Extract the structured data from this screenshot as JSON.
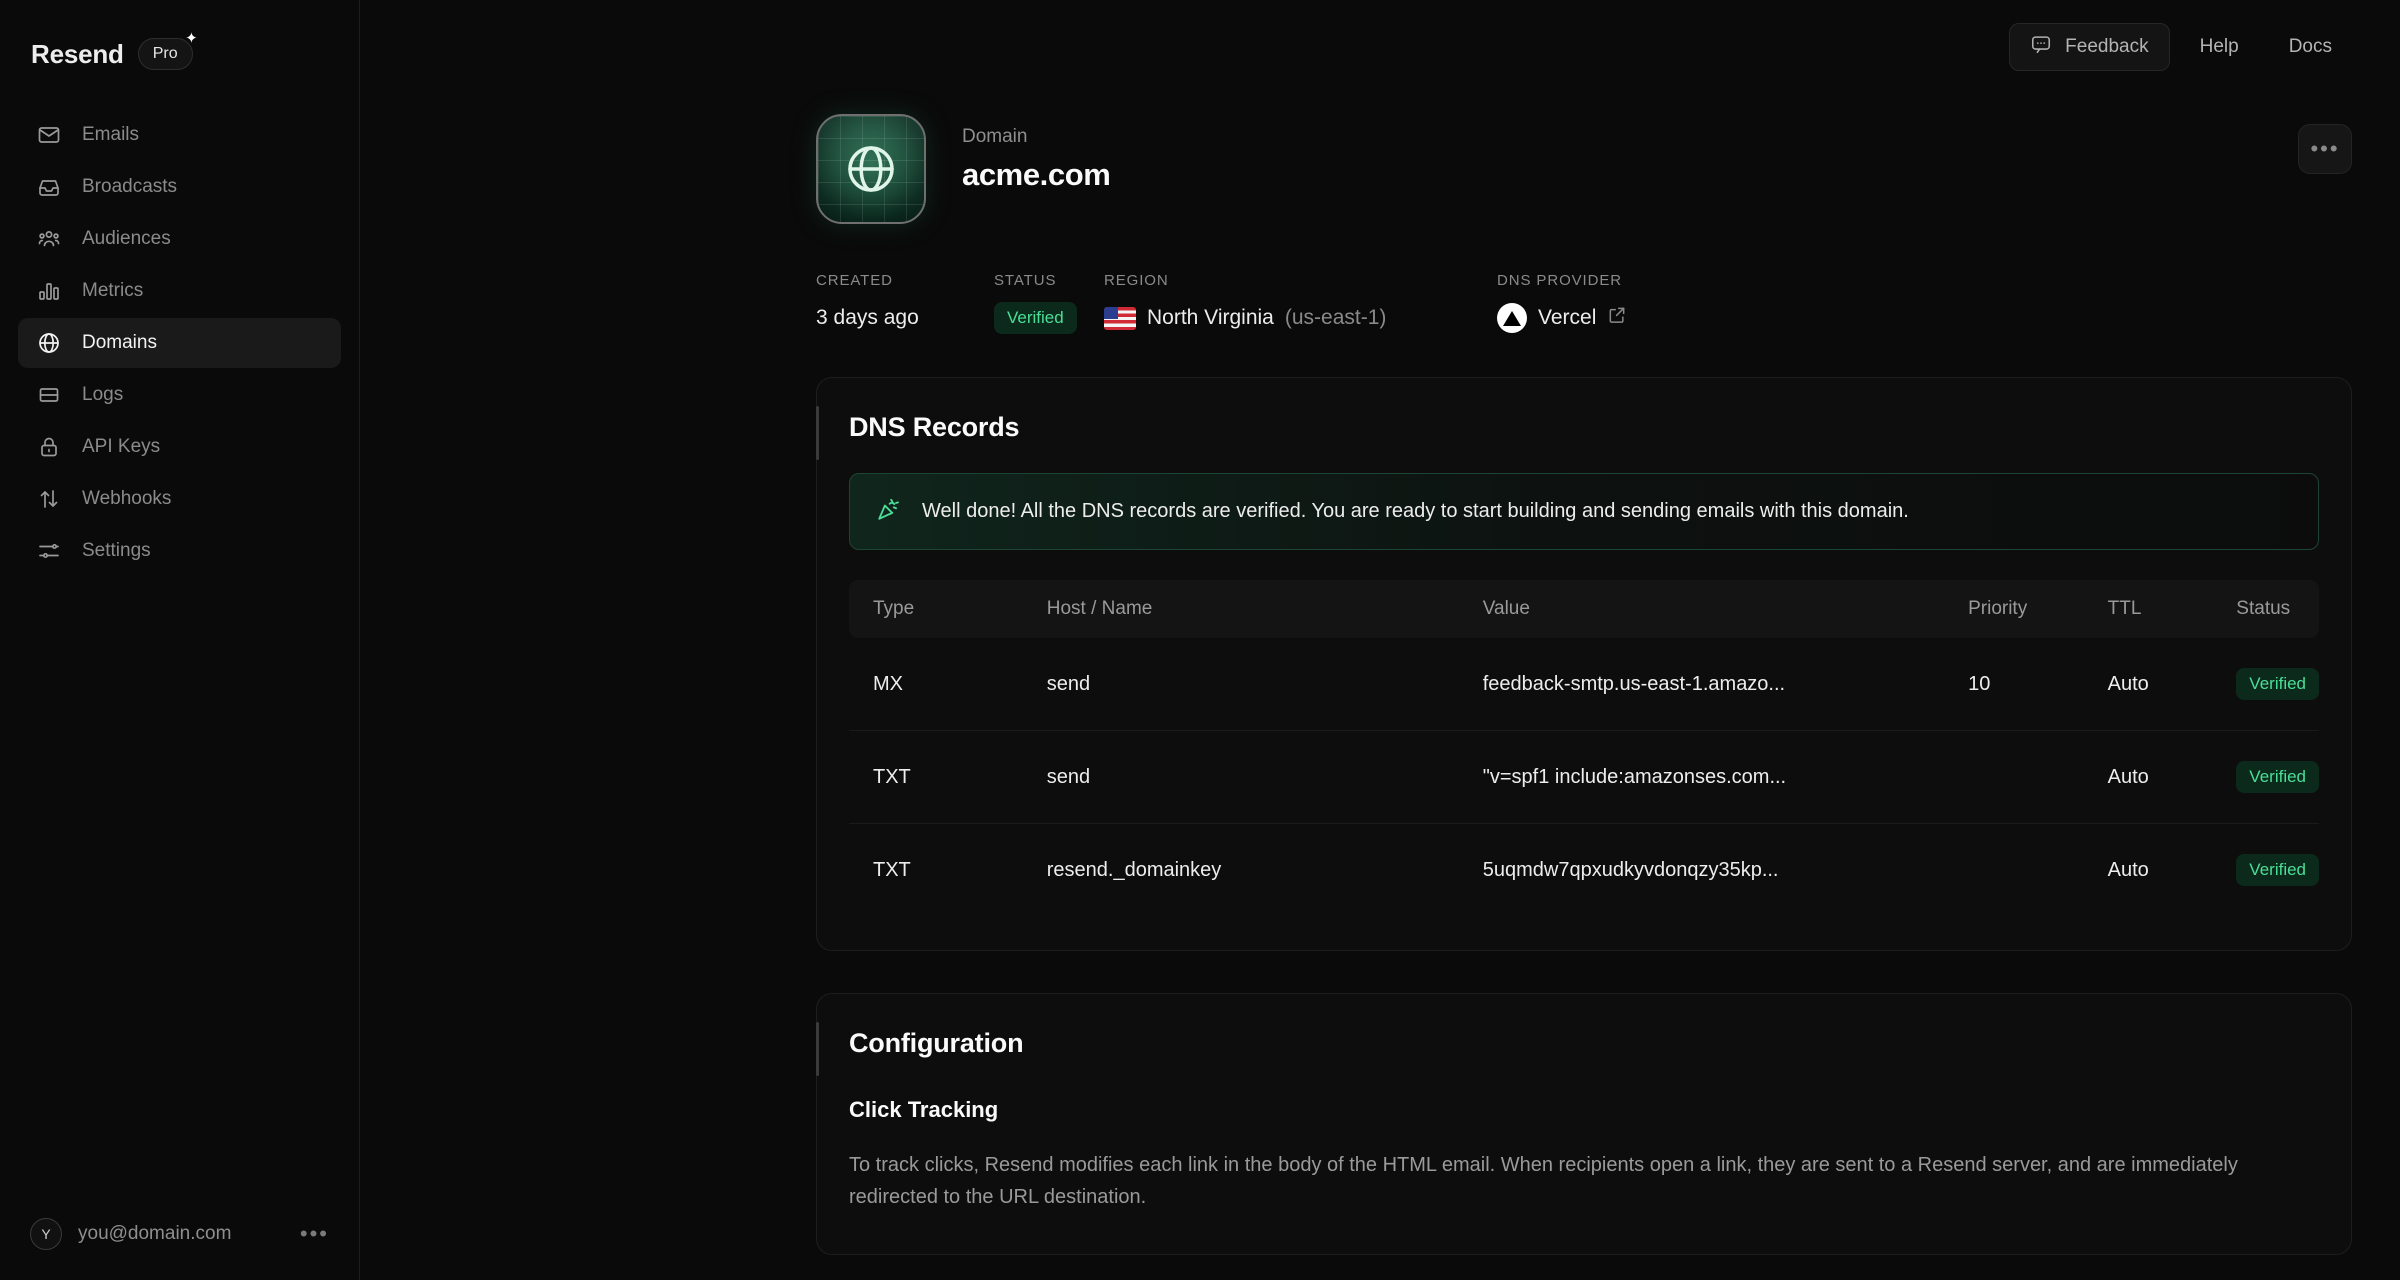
{
  "sidebar": {
    "brand": "Resend",
    "plan_badge": "Pro",
    "items": [
      {
        "label": "Emails",
        "icon": "envelope-icon",
        "active": false
      },
      {
        "label": "Broadcasts",
        "icon": "inbox-icon",
        "active": false
      },
      {
        "label": "Audiences",
        "icon": "people-icon",
        "active": false
      },
      {
        "label": "Metrics",
        "icon": "bar-chart-icon",
        "active": false
      },
      {
        "label": "Domains",
        "icon": "globe-icon",
        "active": true
      },
      {
        "label": "Logs",
        "icon": "list-icon",
        "active": false
      },
      {
        "label": "API Keys",
        "icon": "lock-icon",
        "active": false
      },
      {
        "label": "Webhooks",
        "icon": "arrows-updown-icon",
        "active": false
      },
      {
        "label": "Settings",
        "icon": "sliders-icon",
        "active": false
      }
    ],
    "user": {
      "avatar_initial": "Y",
      "email": "you@domain.com",
      "menu_dots": "•••"
    }
  },
  "topbar": {
    "feedback_label": "Feedback",
    "help_label": "Help",
    "docs_label": "Docs"
  },
  "domain_header": {
    "label": "Domain",
    "name": "acme.com",
    "more_dots": "•••"
  },
  "meta": {
    "created_key": "CREATED",
    "created_value": "3 days ago",
    "status_key": "STATUS",
    "status_value": "Verified",
    "region_key": "REGION",
    "region_value": "North Virginia",
    "region_code": "(us-east-1)",
    "dns_provider_key": "DNS PROVIDER",
    "dns_provider_value": "Vercel"
  },
  "dns_card": {
    "title": "DNS Records",
    "banner": "Well done! All the DNS records are verified. You are ready to start building and sending emails with this domain.",
    "columns": [
      "Type",
      "Host / Name",
      "Value",
      "Priority",
      "TTL",
      "Status"
    ],
    "rows": [
      {
        "type": "MX",
        "host": "send",
        "value": "feedback-smtp.us-east-1.amazo...",
        "priority": "10",
        "ttl": "Auto",
        "status": "Verified"
      },
      {
        "type": "TXT",
        "host": "send",
        "value": "\"v=spf1 include:amazonses.com...",
        "priority": "",
        "ttl": "Auto",
        "status": "Verified"
      },
      {
        "type": "TXT",
        "host": "resend._domainkey",
        "value": "5uqmdw7qpxudkyvdonqzy35kp...",
        "priority": "",
        "ttl": "Auto",
        "status": "Verified"
      }
    ]
  },
  "config_card": {
    "title": "Configuration",
    "subtitle": "Click Tracking",
    "paragraph": "To track clicks, Resend modifies each link in the body of the HTML email. When recipients open a link, they are sent to a Resend server, and are immediately redirected to the URL destination."
  },
  "colors": {
    "accent_green": "#4ade97",
    "verified_bg": "#0c2a1b",
    "page_bg": "#0a0a0a",
    "card_bg": "#0d0d0d"
  }
}
